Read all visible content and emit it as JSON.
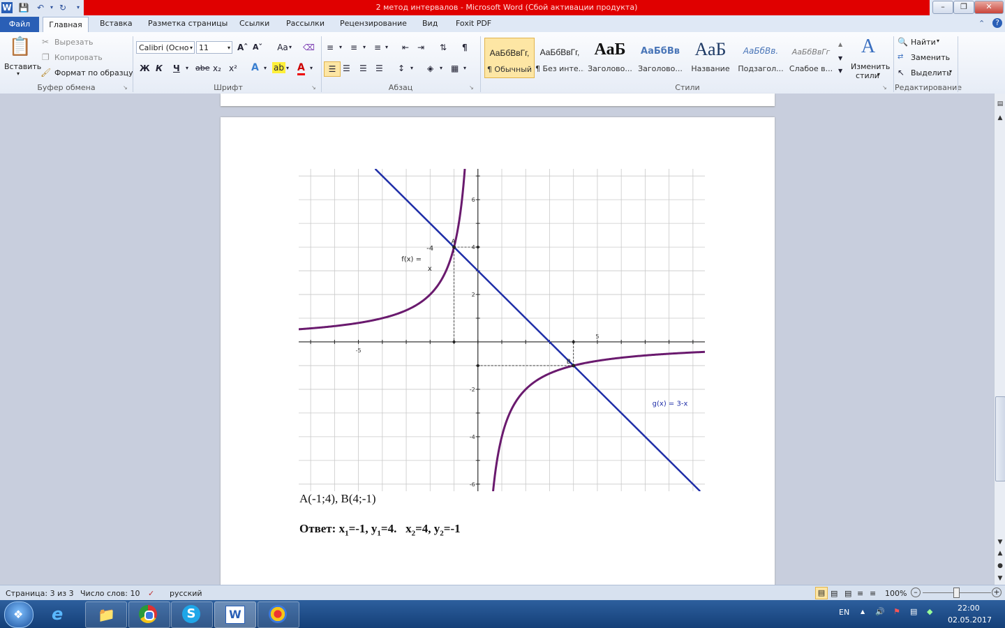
{
  "window": {
    "title": "2 метод интервалов  -  Microsoft Word (Сбой активации продукта)"
  },
  "tabs": {
    "file": "Файл",
    "items": [
      "Главная",
      "Вставка",
      "Разметка страницы",
      "Ссылки",
      "Рассылки",
      "Рецензирование",
      "Вид",
      "Foxit PDF"
    ]
  },
  "ribbon": {
    "clipboard": {
      "label": "Буфер обмена",
      "paste": "Вставить",
      "cut": "Вырезать",
      "copy": "Копировать",
      "format_painter": "Формат по образцу"
    },
    "font": {
      "label": "Шрифт",
      "name": "Calibri (Осно",
      "size": "11",
      "bold": "Ж",
      "italic": "К",
      "underline": "Ч",
      "strike": "abe",
      "case": "Aa",
      "subscript": "x₂",
      "superscript": "x²"
    },
    "paragraph": {
      "label": "Абзац"
    },
    "styles": {
      "label": "Стили",
      "items": [
        {
          "preview": "АаБбВвГг,",
          "name": "¶ Обычный"
        },
        {
          "preview": "АаБбВвГг,",
          "name": "¶ Без инте..."
        },
        {
          "preview": "АаБ",
          "name": "Заголово..."
        },
        {
          "preview": "АаБбВв",
          "name": "Заголово..."
        },
        {
          "preview": "АаБ",
          "name": "Название"
        },
        {
          "preview": "АаБбВв.",
          "name": "Подзагол..."
        },
        {
          "preview": "АаБбВвГг",
          "name": "Слабое в..."
        }
      ],
      "change_styles_line1": "Изменить",
      "change_styles_line2": "стили"
    },
    "editing": {
      "label": "Редактирование",
      "find": "Найти",
      "replace": "Заменить",
      "select": "Выделить"
    }
  },
  "document": {
    "graph": {
      "f_label": "f(x) =",
      "f_numerator": "-4",
      "f_denominator": "x",
      "g_label": "g(x) = 3-x",
      "point_a_label": "A",
      "point_b_label": "B",
      "x_tick_neg": "-5",
      "x_tick_pos": "5",
      "y_ticks": [
        "6",
        "4",
        "2",
        "-2",
        "-4",
        "-6"
      ]
    },
    "points_line": "A(-1;4),  B(4;-1)",
    "answer": {
      "prefix": "Ответ: ",
      "x1": "x",
      "s1": "1",
      "e1": "=-1, ",
      "y1": "y",
      "s2": "1",
      "e2": "=4.   ",
      "x2": "x",
      "s3": "2",
      "e3": "=4, ",
      "y2": "y",
      "s4": "2",
      "e4": "=-1"
    }
  },
  "statusbar": {
    "page": "Страница: 3 из 3",
    "words": "Число слов: 10",
    "language": "русский",
    "zoom": "100%"
  },
  "taskbar": {
    "lang": "EN",
    "time": "22:00",
    "date": "02.05.2017"
  },
  "chart_data": {
    "type": "line",
    "xlim": [
      -7.5,
      9.5
    ],
    "ylim": [
      -6.3,
      7.3
    ],
    "grid": true,
    "x_ticks_labeled": [
      -5,
      5
    ],
    "y_ticks_labeled": [
      6,
      4,
      2,
      -2,
      -4,
      -6
    ],
    "series": [
      {
        "expression": "-4/x",
        "color": "#6a1a6e"
      },
      {
        "expression": "3-x",
        "color": "#1f2ea8"
      }
    ],
    "intersections": [
      {
        "label": "A",
        "x": -1,
        "y": 4
      },
      {
        "label": "B",
        "x": 4,
        "y": -1
      }
    ]
  }
}
